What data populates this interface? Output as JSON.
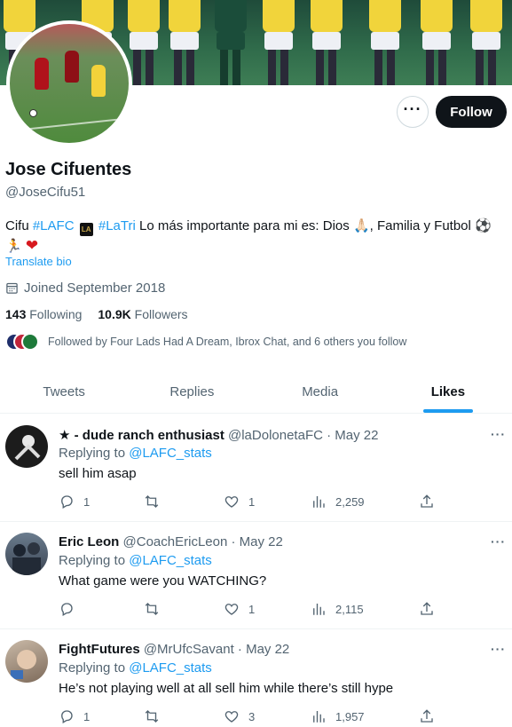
{
  "profile": {
    "name": "Jose Cifuentes",
    "handle": "@JoseCifu51",
    "bio": {
      "prefix": "Cifu ",
      "tag1": "#LAFC",
      "badge": "LA",
      "tag2": "#LaTri",
      "text1": " Lo más importante para mi es: Dios ",
      "emoji_pray": "🙏🏻",
      "text2": ", Familia y Futbol ",
      "emoji_ball": "⚽",
      "emoji_run": "🏃",
      "emoji_heart": "❤"
    },
    "translate_label": "Translate bio",
    "joined": "Joined September 2018",
    "following_count": "143",
    "following_label": "Following",
    "followers_count": "10.9K",
    "followers_label": "Followers",
    "followed_by": "Followed by Four Lads Had A Dream, Ibrox Chat, and 6 others you follow"
  },
  "buttons": {
    "more": "···",
    "follow": "Follow"
  },
  "tabs": [
    "Tweets",
    "Replies",
    "Media",
    "Likes"
  ],
  "active_tab": "Likes",
  "tweets": [
    {
      "name_prefix": "★",
      "name": "- dude ranch enthusiast",
      "meta": "@laDolonetaFC · May 22",
      "replying": "Replying to",
      "reply_to": "@LAFC_stats",
      "text": "sell him asap",
      "replies": "1",
      "retweets": "",
      "likes": "1",
      "views": "2,259"
    },
    {
      "name_prefix": "",
      "name": "Eric Leon",
      "meta": "@CoachEricLeon · May 22",
      "replying": "Replying to",
      "reply_to": "@LAFC_stats",
      "text": "What game were you WATCHING?",
      "replies": "",
      "retweets": "",
      "likes": "1",
      "views": "2,115"
    },
    {
      "name_prefix": "",
      "name": "FightFutures",
      "meta": "@MrUfcSavant · May 22",
      "replying": "Replying to",
      "reply_to": "@LAFC_stats",
      "text": "He’s not playing well at all sell him while there’s still hype",
      "replies": "1",
      "retweets": "",
      "likes": "3",
      "views": "1,957"
    }
  ],
  "colors": {
    "accent": "#1d9bf0",
    "text": "#0f1419",
    "muted": "#536471",
    "follow_bg": "#0f1419"
  }
}
